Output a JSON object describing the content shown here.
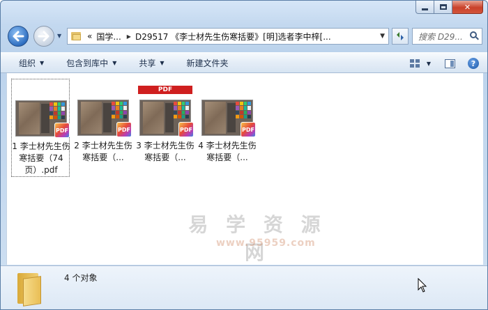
{
  "window": {
    "address": {
      "overflow": "«",
      "crumbs": [
        "国学...",
        "D29517 《李士材先生伤寒括要》[明]选者李中梓[..."
      ]
    },
    "search_placeholder": "搜索 D29...",
    "caption": {
      "close": "✕"
    }
  },
  "toolbar": {
    "organize": "组织",
    "include_in_library": "包含到库中",
    "share": "共享",
    "new_folder": "新建文件夹"
  },
  "files": [
    {
      "label": "1 李士材先生伤寒括要（74页）.pdf",
      "selected": true,
      "red_header": false
    },
    {
      "label": "2 李士材先生伤寒括要（...",
      "selected": false,
      "red_header": false
    },
    {
      "label": "3 李士材先生伤寒括要（...",
      "selected": false,
      "red_header": true
    },
    {
      "label": "4 李士材先生伤寒括要（...",
      "selected": false,
      "red_header": false
    }
  ],
  "thumb": {
    "strip_label": "PDF",
    "badge_label": "PDF"
  },
  "watermark": {
    "text": "易 学 资 源 网",
    "url": "www.95959.com"
  },
  "status": {
    "object_count": "4 个对象"
  },
  "colors": {
    "pdf_red": "#cf1f1f",
    "frame_blue": "#5a7ea6"
  }
}
